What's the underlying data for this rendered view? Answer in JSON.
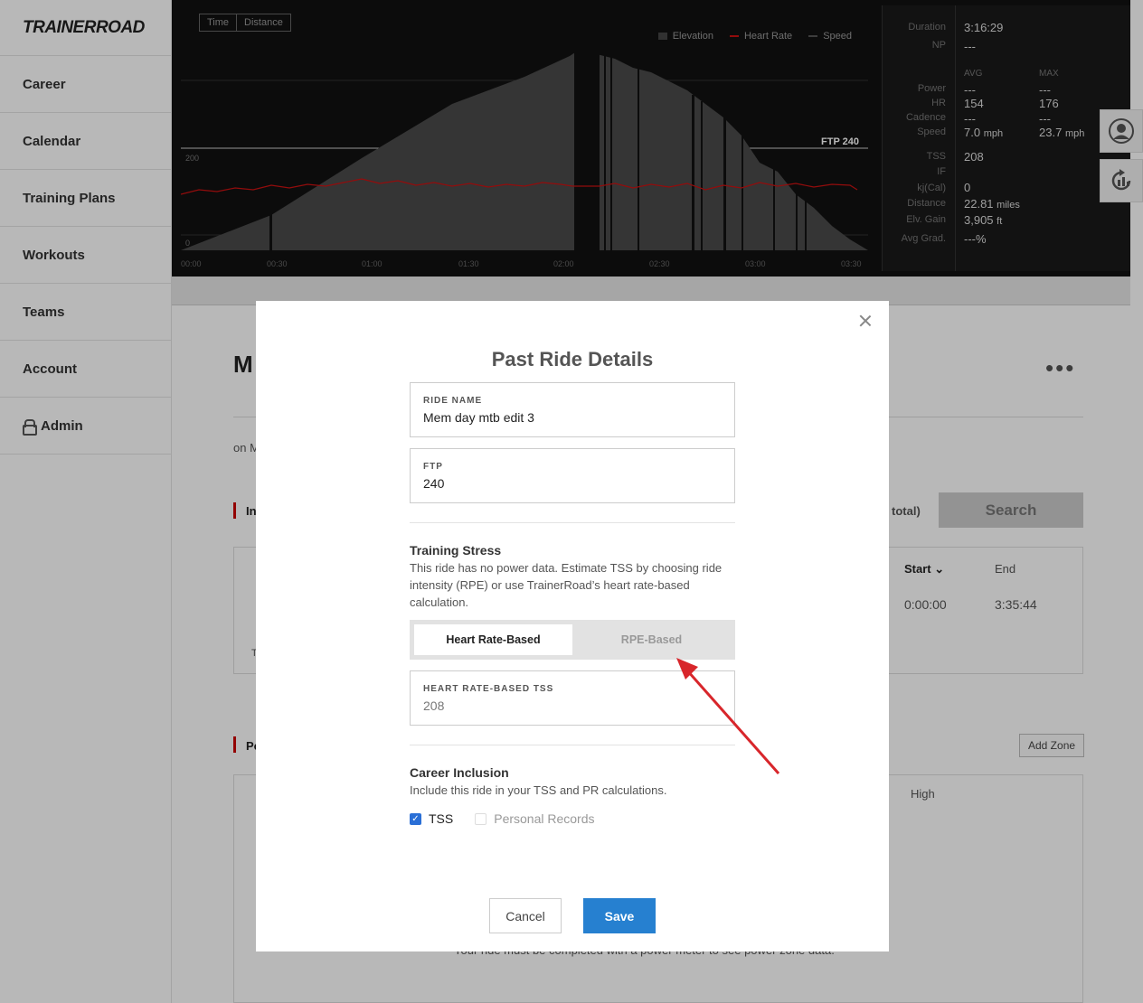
{
  "app": {
    "logo": "TRAINERROAD"
  },
  "sidebar": {
    "items": [
      {
        "label": "Career"
      },
      {
        "label": "Calendar"
      },
      {
        "label": "Training Plans"
      },
      {
        "label": "Workouts"
      },
      {
        "label": "Teams"
      },
      {
        "label": "Account"
      },
      {
        "label": "Admin"
      }
    ]
  },
  "graph": {
    "toggle": [
      "Time",
      "Distance"
    ],
    "legend": [
      {
        "label": "Elevation",
        "color": "#444444"
      },
      {
        "label": "Heart Rate",
        "color": "#cc1111"
      },
      {
        "label": "Speed",
        "color": "#555555"
      }
    ],
    "ftp_label": "FTP 240",
    "y_ticks": [
      "200",
      "0"
    ],
    "x_ticks": [
      "00:00",
      "00:30",
      "01:00",
      "01:30",
      "02:00",
      "02:30",
      "03:00",
      "03:30"
    ]
  },
  "stats": {
    "duration_label": "Duration",
    "duration": "3:16:29",
    "np_label": "NP",
    "np": "---",
    "avg_label": "AVG",
    "max_label": "MAX",
    "power_label": "Power",
    "power_avg": "---",
    "power_max": "---",
    "hr_label": "HR",
    "hr_avg": "154",
    "hr_max": "176",
    "cadence_label": "Cadence",
    "cadence_avg": "---",
    "cadence_max": "---",
    "speed_label": "Speed",
    "speed_avg": "7.0",
    "speed_max": "23.7",
    "speed_unit": "mph",
    "tss_label": "TSS",
    "tss": "208",
    "if_label": "IF",
    "if": "",
    "kj_label": "kj(Cal)",
    "kj": "0",
    "distance_label": "Distance",
    "distance": "22.81",
    "distance_unit": "miles",
    "elev_label": "Elv. Gain",
    "elev": "3,905",
    "elev_unit": "ft",
    "grad_label": "Avg Grad.",
    "grad": "---%"
  },
  "background": {
    "title": "M",
    "on_text": "on M",
    "section1": "In",
    "total_text": "total)",
    "search_label": "Search",
    "col_start": "Start",
    "col_end": "End",
    "start_val": "0:00:00",
    "end_val": "3:35:44",
    "row_t": "T",
    "section2": "Po",
    "add_zone": "Add Zone",
    "col_high": "High",
    "power_note": "Your ride must be completed with a power meter to see power zone data."
  },
  "modal": {
    "title": "Past Ride Details",
    "ride_name_label": "RIDE NAME",
    "ride_name": "Mem day mtb edit 3",
    "ftp_label": "FTP",
    "ftp": "240",
    "training_stress_heading": "Training Stress",
    "training_stress_text": "This ride has no power data. Estimate TSS by choosing ride intensity (RPE) or use TrainerRoad’s heart rate-based calculation.",
    "tab_hr": "Heart Rate-Based",
    "tab_rpe": "RPE-Based",
    "hr_tss_label": "HEART RATE-BASED TSS",
    "hr_tss": "208",
    "career_heading": "Career Inclusion",
    "career_text": "Include this ride in your TSS and PR calculations.",
    "cb_tss": "TSS",
    "cb_pr": "Personal Records",
    "cancel": "Cancel",
    "save": "Save"
  },
  "colors": {
    "accent": "#2680d0",
    "arrow": "#d8262b",
    "hr_line": "#cc1111"
  }
}
